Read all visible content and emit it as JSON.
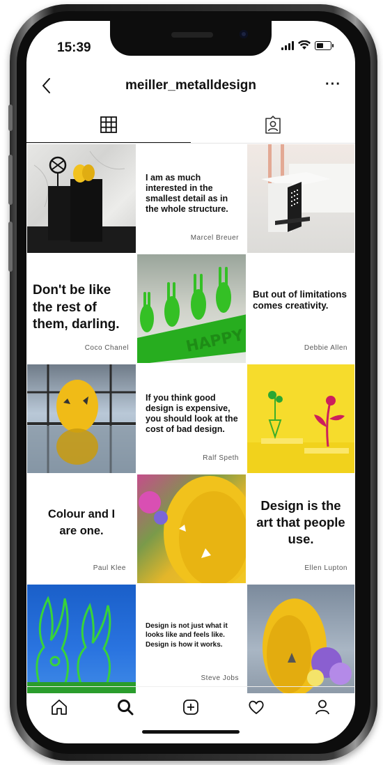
{
  "status": {
    "time": "15:39"
  },
  "header": {
    "title": "meiller_metalldesign",
    "more": "···"
  },
  "tabs": [
    {
      "name": "grid"
    },
    {
      "name": "tagged"
    }
  ],
  "posts": [
    {
      "type": "photo",
      "desc": "black metal stands with yellow egg and bunny wheel"
    },
    {
      "type": "quote",
      "quote": "I am as much interested in the smallest detail as in the whole structure.",
      "author": "Marcel Breuer"
    },
    {
      "type": "photo",
      "desc": "black perforated side table"
    },
    {
      "type": "quote",
      "quote": "Don't be like the rest of them, darling.",
      "author": "Coco Chanel"
    },
    {
      "type": "photo",
      "desc": "green bunny Happy Easter decoration"
    },
    {
      "type": "quote",
      "quote": "But out of limitations comes creativity.",
      "author": "Debbie Allen"
    },
    {
      "type": "photo",
      "desc": "yellow egg reflected on table by window"
    },
    {
      "type": "quote",
      "quote": "If you think good design is expensive, you should look at the cost of bad design.",
      "author": "Ralf Speth"
    },
    {
      "type": "photo",
      "desc": "yellow flower decor"
    },
    {
      "type": "quote",
      "quote": "Colour and I are one.",
      "author": "Paul Klee"
    },
    {
      "type": "photo",
      "desc": "yellow egg close-up with flowers"
    },
    {
      "type": "quote",
      "quote": "Design is the art that people use.",
      "author": "Ellen Lupton"
    },
    {
      "type": "photo",
      "desc": "green bunny outlines against blue sky"
    },
    {
      "type": "quote",
      "quote": "Design is not just what it looks like and feels like. Design is how it works.",
      "author": "Steve Jobs"
    },
    {
      "type": "photo",
      "desc": "yellow egg with flowers"
    }
  ],
  "bottom_nav": [
    "home-icon",
    "search-icon",
    "add-post-icon",
    "heart-icon",
    "profile-icon"
  ],
  "colors": {
    "yellow": "#f4c92a",
    "green": "#2fbf2c",
    "sky": "#1f6fd6"
  }
}
